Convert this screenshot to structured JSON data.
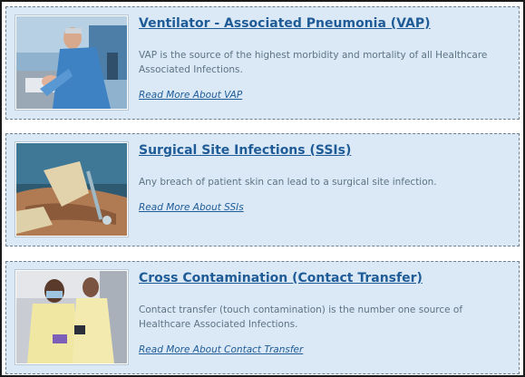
{
  "articles": [
    {
      "title": "Ventilator - Associated Pneumonia (VAP)",
      "description": "VAP is the source of the highest morbidity and mortality of all Healthcare Associated Infections.",
      "link_text": "Read More About VAP",
      "image": "doctor-with-ventilator-patient-photo"
    },
    {
      "title": "Surgical Site Infections (SSIs)",
      "description": "Any breach of patient skin can lead to a surgical site infection.",
      "link_text": "Read More About SSIs",
      "image": "surgical-procedure-photo"
    },
    {
      "title": "Cross Contamination (Contact Transfer)",
      "description": "Contact transfer (touch contamination) is the number one source of Healthcare Associated Infections.",
      "link_text": "Read More About Contact Transfer",
      "image": "clinicians-in-gowns-photo"
    }
  ],
  "colors": {
    "card_background": "#dbe9f7",
    "link": "#1f5c97",
    "body_text": "#5e7382"
  }
}
